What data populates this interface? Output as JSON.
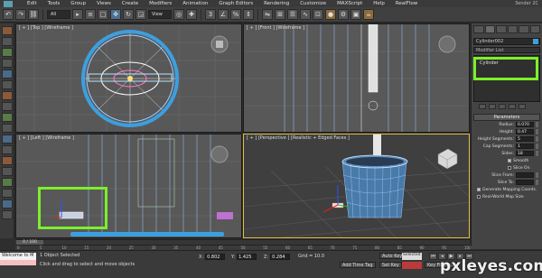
{
  "menu": {
    "items": [
      "Edit",
      "Tools",
      "Group",
      "Views",
      "Create",
      "Modifiers",
      "Animation",
      "Graph Editors",
      "Rendering",
      "Customize",
      "MAXScript",
      "Help",
      "RealFlow"
    ],
    "title_right": "3ender 2C"
  },
  "toolbar": {
    "selection_filter": "All",
    "view_dropdown": "View"
  },
  "viewports": {
    "top_label": "[ + ] [Top ] [Wireframe ]",
    "front_label": "[ + ] [Front ] [Wireframe ]",
    "left_label": "[ + ] [Left ] [Wireframe ]",
    "persp_label": "[ + ] [Perspective ] [Realistic + Edged Faces ]"
  },
  "command_panel": {
    "object_name": "Cylinder002",
    "object_color": "#3c9fe0",
    "modifier_list": "Modifier List",
    "stack_item": "Cylinder",
    "parameters_title": "Parameters",
    "params": [
      {
        "label": "Radius:",
        "value": "0.070"
      },
      {
        "label": "Height:",
        "value": "0.47"
      },
      {
        "label": "Height Segments:",
        "value": "5"
      },
      {
        "label": "Cap Segments:",
        "value": "1"
      },
      {
        "label": "Sides:",
        "value": "18"
      }
    ],
    "smooth_label": "Smooth",
    "slice_on_label": "Slice On",
    "slice_from_label": "Slice From:",
    "slice_to_label": "Slice To:",
    "gen_mapping_label": "Generate Mapping Coords.",
    "real_world_label": "Real-World Map Size"
  },
  "timeline": {
    "slider_text": "0 / 100",
    "ticks": [
      "0",
      "5",
      "10",
      "15",
      "20",
      "25",
      "30",
      "35",
      "40",
      "45",
      "50",
      "55",
      "60",
      "65",
      "70",
      "75",
      "80",
      "85",
      "90",
      "95",
      "100"
    ]
  },
  "status": {
    "welcome": "Welcome to M",
    "selected_text": "1 Object Selected",
    "hint_text": "Click and drag to select and move objects",
    "x_label": "X:",
    "x_value": "0.802",
    "y_label": "Y:",
    "y_value": "1.425",
    "z_label": "Z:",
    "z_value": "0.284",
    "grid_text": "Grid = 10.0",
    "add_time_tag": "Add Time Tag",
    "auto_key": "Auto Key",
    "set_key": "Set Key",
    "selected_dropdown": "Selected",
    "key_filters": "Key Filters..."
  },
  "watermark": "pxleyes.com",
  "colors": {
    "highlight_green": "#7cf02a",
    "wire_blue": "#3c9fe0",
    "active_viewport_border": "#e0c040"
  }
}
